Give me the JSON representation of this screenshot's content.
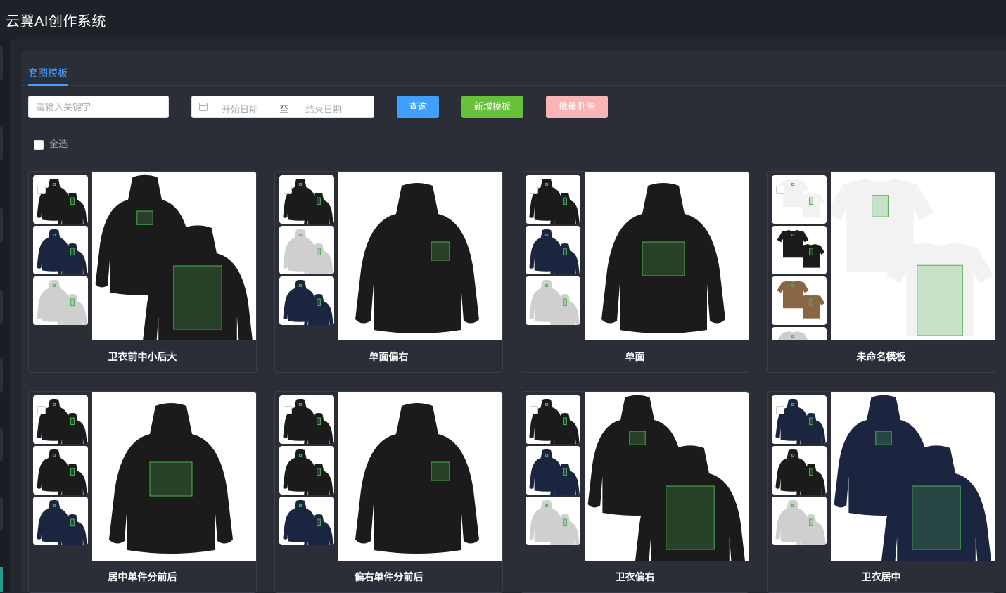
{
  "app": {
    "title": "云翼AI创作系统"
  },
  "tabs": [
    {
      "label": "套图模板"
    }
  ],
  "filters": {
    "keyword_placeholder": "请输入关键字",
    "start_placeholder": "开始日期",
    "range_separator": "至",
    "end_placeholder": "结束日期"
  },
  "buttons": {
    "query": "查询",
    "add": "新增模板",
    "batch_delete": "批量删除"
  },
  "select_all": "全选",
  "colors": {
    "primary": "#409eff",
    "success": "#67c23a",
    "danger_light": "#fab6b6",
    "print_box": "#4caf50"
  },
  "templates": [
    {
      "name": "卫衣前中小后大",
      "product": "hoodie",
      "main": "pair",
      "thumbs": [
        "black",
        "navy",
        "gray"
      ]
    },
    {
      "name": "单面偏右",
      "product": "hoodie",
      "main": "single-right",
      "thumbs": [
        "black",
        "gray",
        "navy"
      ]
    },
    {
      "name": "单面",
      "product": "hoodie",
      "main": "single-center",
      "thumbs": [
        "black",
        "navy",
        "gray"
      ]
    },
    {
      "name": "未命名模板",
      "product": "tshirt",
      "main": "pair",
      "thumbs": [
        "white",
        "black",
        "brown",
        "gray"
      ]
    },
    {
      "name": "居中单件分前后",
      "product": "hoodie",
      "main": "single-center",
      "thumbs": [
        "black",
        "black",
        "navy"
      ]
    },
    {
      "name": "偏右单件分前后",
      "product": "hoodie",
      "main": "single-right",
      "thumbs": [
        "black",
        "black",
        "navy"
      ]
    },
    {
      "name": "卫衣偏右",
      "product": "hoodie",
      "main": "pair",
      "thumbs": [
        "black",
        "navy",
        "gray"
      ]
    },
    {
      "name": "卫衣居中",
      "product": "hoodie",
      "main": "pair-navy",
      "thumbs": [
        "navy",
        "black",
        "gray"
      ]
    }
  ]
}
